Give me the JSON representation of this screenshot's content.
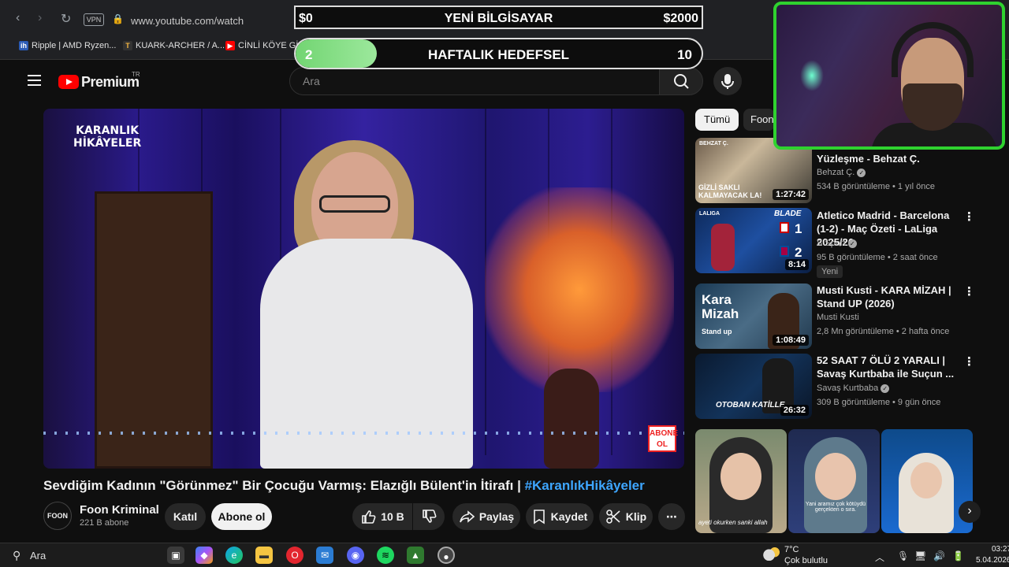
{
  "browser": {
    "url": "www.youtube.com/watch",
    "vpn_label": "VPN",
    "bookmarks": [
      {
        "label": "Ripple | AMD Ryzen...",
        "icon": "ih"
      },
      {
        "label": "KUARK-ARCHER / A...",
        "icon": "T"
      },
      {
        "label": "CİNLİ KÖYE GİR",
        "icon": "yt"
      }
    ]
  },
  "overlay": {
    "goal1_left": "$0",
    "goal1_title": "YENİ BİLGİSAYAR",
    "goal1_right": "$2000",
    "goal2_left": "2",
    "goal2_title": "HAFTALIK HEDEFSEL",
    "goal2_right": "10",
    "goal2_progress": 0.2
  },
  "youtube": {
    "brand": "Premium",
    "country": "TR",
    "search_placeholder": "Ara"
  },
  "video": {
    "logo_line1": "KARANLIK",
    "logo_line2": "HİKÂYELER",
    "badge_line1": "ABONE",
    "badge_line2": "OL",
    "title": "Sevdiğim Kadının \"Görünmez\" Bir Çocuğu Varmış: Elazığlı Bülent'in İtirafı |",
    "hashtag": "#KaranlıkHikâyeler",
    "channel_avatar": "FOON",
    "channel_name": "Foon Kriminal",
    "subscribers": "221 B abone",
    "join_label": "Katıl",
    "subscribe_label": "Abone ol",
    "likes": "10 B",
    "share_label": "Paylaş",
    "save_label": "Kaydet",
    "clip_label": "Klip",
    "more_label": "⋯"
  },
  "sidebar": {
    "chips": [
      "Tümü",
      "Foon"
    ],
    "items": [
      {
        "title": "Yüzleşme - Behzat Ç.",
        "channel": "Behzat Ç.",
        "meta": "534 B görüntüleme • 1 yıl önce",
        "duration": "1:27:42",
        "thumb_text": "GİZLİ SAKLI KALMAYACAK LA!",
        "corner_text": "BEHZAT Ç."
      },
      {
        "title": "Atletico Madrid - Barcelona (1-2) - Maç Özeti - LaLiga 2025/26",
        "channel": "S Sport",
        "meta": "95 B görüntüleme • 2 saat önce",
        "badge": "Yeni",
        "duration": "8:14",
        "thumb_text": "BLADE",
        "corner_text": "LALIGA",
        "score_home": "1",
        "score_away": "2"
      },
      {
        "title": "Musti Kusti - KARA MİZAH | Stand UP (2026)",
        "channel": "Musti Kusti",
        "meta": "2,8 Mn görüntüleme • 2 hafta önce",
        "duration": "1:08:49",
        "thumb_text": "Kara Mizah",
        "corner_text": "Stand up"
      },
      {
        "title": "52 SAAT 7 ÖLÜ 2 YARALI | Savaş Kurtbaba ile Suçun ...",
        "channel": "Savaş Kurtbaba",
        "meta": "309 B görüntüleme • 9 gün önce",
        "duration": "26:32",
        "thumb_text": "OTOBAN KATİLLE"
      }
    ],
    "shorts": [
      {
        "caption": "ayeti okurken sanki allah"
      },
      {
        "caption": "Yani aramız çok kötüydü gerçekten o sıra."
      },
      {
        "caption": ""
      }
    ]
  },
  "taskbar": {
    "search_label": "Ara",
    "temperature": "7°C",
    "weather": "Çok bulutlu",
    "time": "03:27",
    "date": "5.04.2026"
  },
  "colors": {
    "accent_link": "#3ea6ff",
    "youtube_red": "#ff0000",
    "cam_border": "#2fd22f",
    "goal_fill": "#72d572"
  }
}
